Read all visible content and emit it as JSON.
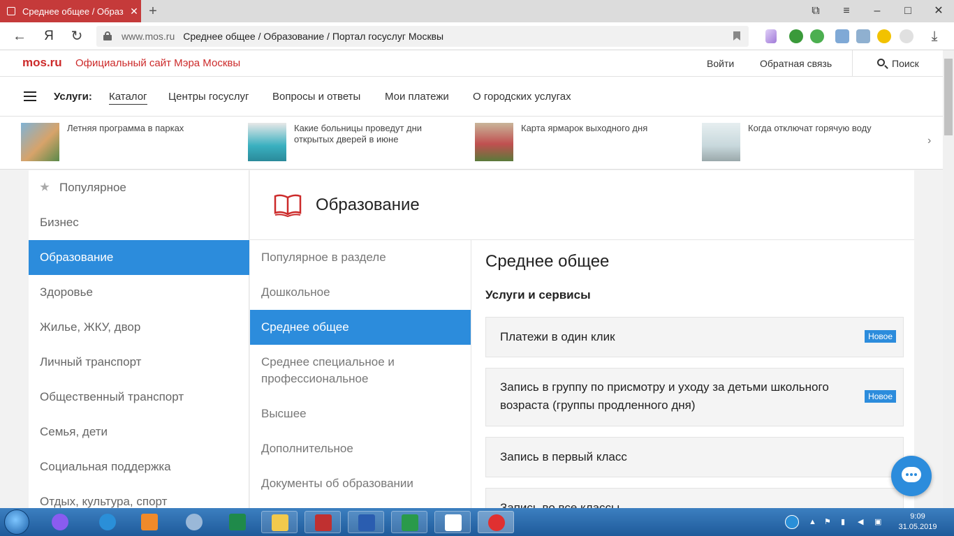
{
  "browser": {
    "tab_title": "Среднее общее / Образ",
    "url_domain": "www.mos.ru",
    "url_title": "Среднее общее / Образование / Портал госуслуг Москвы"
  },
  "site_header": {
    "logo": "mos.ru",
    "tagline": "Официальный сайт Мэра Москвы",
    "login": "Войти",
    "feedback": "Обратная связь",
    "search": "Поиск"
  },
  "services_nav": {
    "label": "Услуги:",
    "items": [
      "Каталог",
      "Центры госуслуг",
      "Вопросы и ответы",
      "Мои платежи",
      "О городских услугах"
    ]
  },
  "news": [
    {
      "text": "Летняя программа в парках"
    },
    {
      "text": "Какие больницы проведут дни открытых дверей в июне"
    },
    {
      "text": "Карта ярмарок выходного дня"
    },
    {
      "text": "Когда отключат горячую воду"
    }
  ],
  "left_nav": [
    "Популярное",
    "Бизнес",
    "Образование",
    "Здоровье",
    "Жилье, ЖКУ, двор",
    "Личный транспорт",
    "Общественный транспорт",
    "Семья, дети",
    "Социальная поддержка",
    "Отдых, культура, спорт"
  ],
  "panel": {
    "title": "Образование"
  },
  "mid_nav": [
    "Популярное в разделе",
    "Дошкольное",
    "Среднее общее",
    "Среднее специальное и профессиональное",
    "Высшее",
    "Дополнительное",
    "Документы об образовании"
  ],
  "content": {
    "title": "Среднее общее",
    "subtitle": "Услуги и сервисы",
    "cards": [
      {
        "text": "Платежи в один клик",
        "badge": "Новое"
      },
      {
        "text": "Запись в группу по присмотру и уходу за детьми школьного возраста (группы продленного дня)",
        "badge": "Новое"
      },
      {
        "text": "Запись в первый класс",
        "badge": ""
      },
      {
        "text": "Запись во все классы",
        "badge": ""
      }
    ]
  },
  "taskbar": {
    "time": "9:09",
    "date": "31.05.2019"
  },
  "colors": {
    "brand_red": "#cc2a2a",
    "accent_blue": "#2c8cdc"
  }
}
